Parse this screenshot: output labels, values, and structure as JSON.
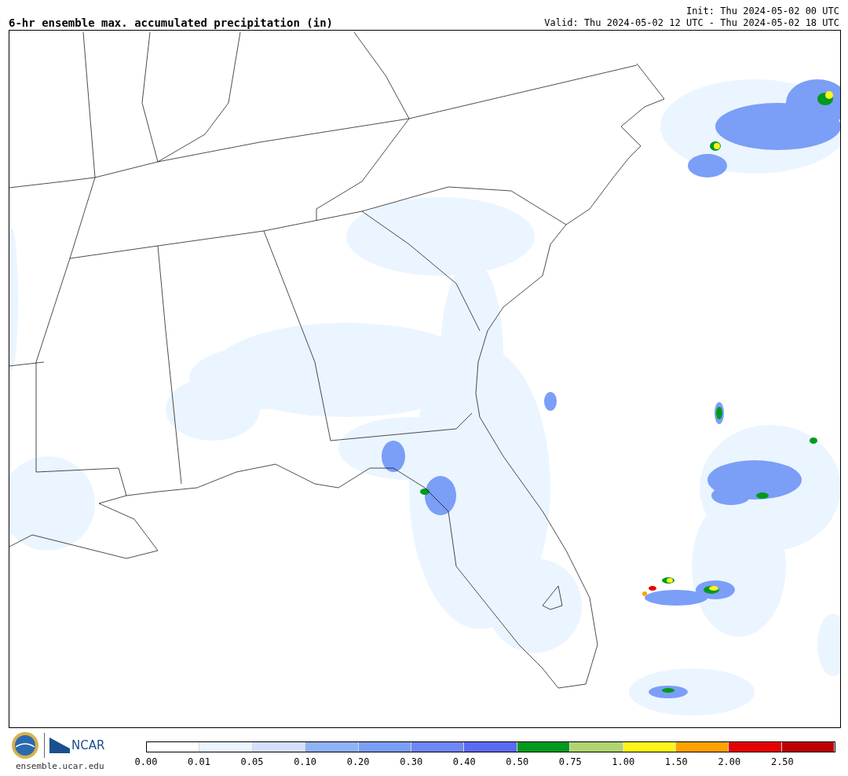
{
  "header": {
    "title": "6-hr ensemble max. accumulated precipitation (in)",
    "init": "Init: Thu 2024-05-02 00 UTC",
    "valid": "Valid: Thu 2024-05-02 12 UTC - Thu 2024-05-02 18 UTC"
  },
  "footer": {
    "logo_text": "NCAR",
    "site": "ensemble.ucar.edu"
  },
  "legend": {
    "bins": [
      {
        "color": "#ffffff"
      },
      {
        "color": "#ebf5ff"
      },
      {
        "color": "#d5e1fc"
      },
      {
        "color": "#8fb2f7"
      },
      {
        "color": "#7b9ef7"
      },
      {
        "color": "#6f86f6"
      },
      {
        "color": "#5b6af3"
      },
      {
        "color": "#009a1f"
      },
      {
        "color": "#b0d46e"
      },
      {
        "color": "#fff51a"
      },
      {
        "color": "#ffa200"
      },
      {
        "color": "#e60000"
      },
      {
        "color": "#be0000"
      }
    ],
    "labels": [
      "0.00",
      "0.01",
      "0.05",
      "0.10",
      "0.20",
      "0.30",
      "0.40",
      "0.50",
      "0.75",
      "1.00",
      "1.50",
      "2.00",
      "2.50"
    ]
  }
}
